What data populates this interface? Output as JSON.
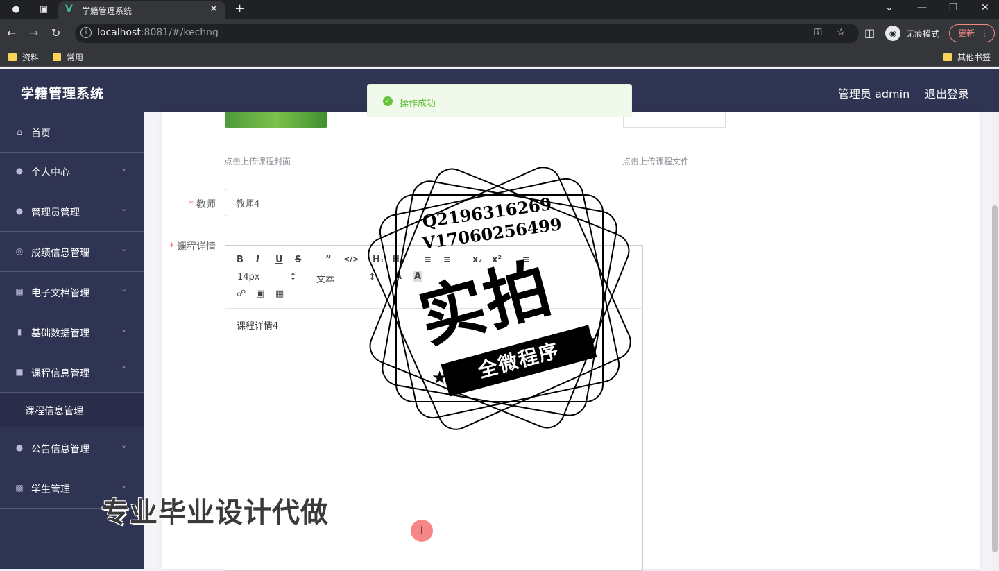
{
  "browser": {
    "tab_title": "学籍管理系统",
    "url_host": "localhost",
    "url_rest": ":8081/#/kechng",
    "incognito_label": "无痕模式",
    "update_label": "更新",
    "bookmarks": [
      "资料",
      "常用"
    ],
    "other_bookmarks": "其他书签"
  },
  "app": {
    "title": "学籍管理系统",
    "admin_label": "管理员 admin",
    "logout_label": "退出登录"
  },
  "sidebar": {
    "items": [
      {
        "label": "首页",
        "icon": "home-icon"
      },
      {
        "label": "个人中心",
        "icon": "user-icon"
      },
      {
        "label": "管理员管理",
        "icon": "admin-icon"
      },
      {
        "label": "成绩信息管理",
        "icon": "mic-icon"
      },
      {
        "label": "电子文档管理",
        "icon": "document-icon"
      },
      {
        "label": "基础数据管理",
        "icon": "chart-icon"
      },
      {
        "label": "课程信息管理",
        "icon": "chat-icon"
      },
      {
        "label": "公告信息管理",
        "icon": "user-icon"
      },
      {
        "label": "学生管理",
        "icon": "briefcase-icon"
      }
    ],
    "submenu": {
      "label": "课程信息管理"
    }
  },
  "form": {
    "cover_hint": "点击上传课程封面",
    "file_hint": "点击上传课程文件",
    "teacher_label": "教师",
    "teacher_value": "教师4",
    "detail_label": "课程详情",
    "editor": {
      "font_size": "14px",
      "font_family": "文本",
      "content": "课程详情4"
    }
  },
  "toast": {
    "message": "操作成功"
  },
  "watermark": {
    "line1": "Q2196316269",
    "line2": "V17060256499",
    "big": "实拍",
    "ribbon": "全微程序",
    "bottom": "专业毕业设计代做"
  }
}
